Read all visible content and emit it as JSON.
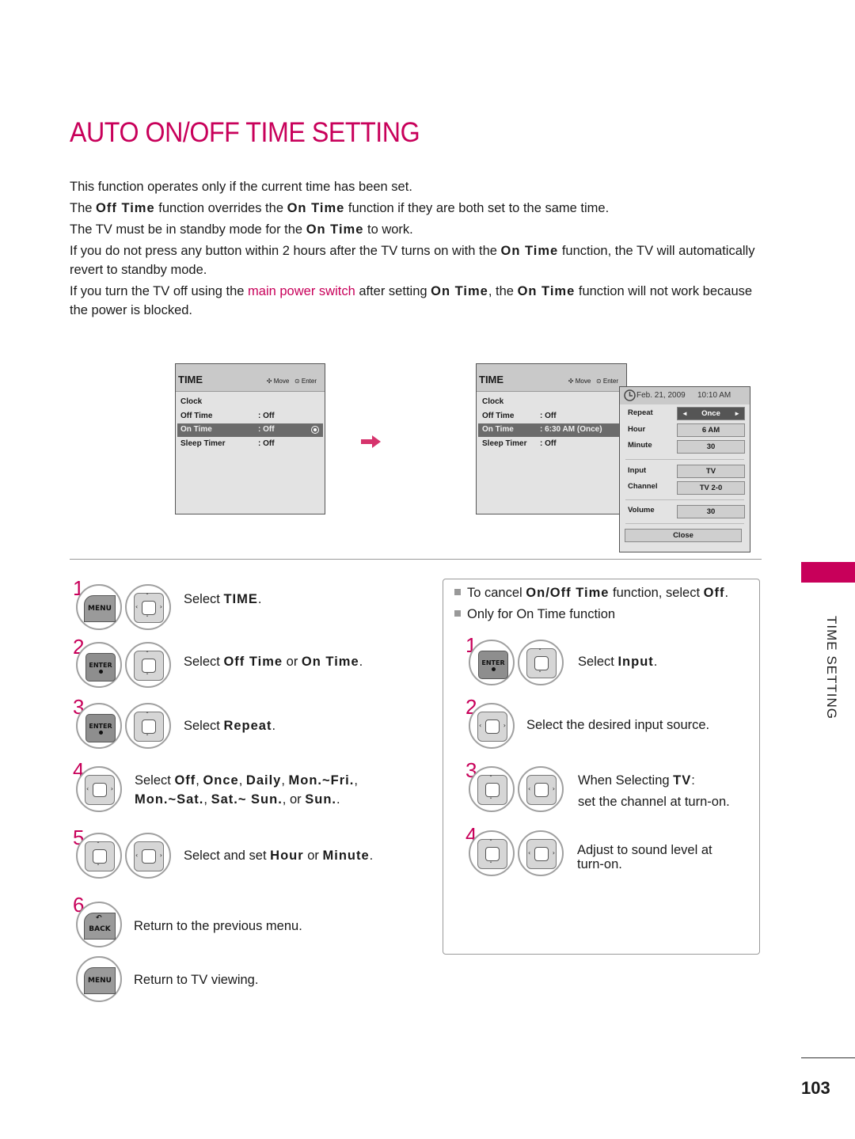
{
  "title": "AUTO ON/OFF TIME SETTING",
  "intro": {
    "p1": "This function operates only if the current time has been set.",
    "p2": {
      "a": "The ",
      "b1": "Off Time",
      "c": " function overrides the ",
      "b2": "On Time",
      "d": " function if they are both set to the same time."
    },
    "p3": {
      "a": "The TV must be in standby mode for the ",
      "b1": "On Time",
      "c": " to work."
    },
    "p4": {
      "a": "If you do not press any button within 2 hours after the TV turns on with the ",
      "b1": "On Time",
      "c": " function, the TV will automatically revert to standby mode."
    },
    "p5": {
      "a": "If you turn the TV off using the ",
      "link": "main power switch",
      "c": " after setting ",
      "b1": "On Time",
      "d": ", the ",
      "b2": "On Time",
      "e": " function will not work because the power is blocked."
    }
  },
  "osd_left": {
    "title": "TIME",
    "hint_move": "Move",
    "hint_enter": "Enter",
    "rows": [
      {
        "label": "Clock",
        "value": ""
      },
      {
        "label": "Off Time",
        "value": ": Off"
      },
      {
        "label": "On Time",
        "value": ": Off",
        "selected": true
      },
      {
        "label": "Sleep Timer",
        "value": ": Off"
      }
    ]
  },
  "osd_right": {
    "title": "TIME",
    "hint_move": "Move",
    "hint_enter": "Enter",
    "rows": [
      {
        "label": "Clock",
        "value": ""
      },
      {
        "label": "Off Time",
        "value": ": Off"
      },
      {
        "label": "On Time",
        "value": ": 6:30 AM (Once)",
        "selected": true
      },
      {
        "label": "Sleep Timer",
        "value": ": Off"
      }
    ]
  },
  "popup": {
    "datetime": "Feb. 21, 2009",
    "clock": "10:10 AM",
    "repeat_label": "Repeat",
    "repeat_value": "Once",
    "hour_label": "Hour",
    "hour_value": "6 AM",
    "minute_label": "Minute",
    "minute_value": "30",
    "input_label": "Input",
    "input_value": "TV",
    "channel_label": "Channel",
    "channel_value": "TV 2-0",
    "volume_label": "Volume",
    "volume_value": "30",
    "close_label": "Close"
  },
  "steps": [
    {
      "num": "1",
      "buttons": [
        "MENU",
        "dpad"
      ],
      "text": {
        "a": "Select ",
        "b": "TIME",
        "c": "."
      }
    },
    {
      "num": "2",
      "buttons": [
        "ENTER",
        "dpad-ud"
      ],
      "text": {
        "a": "Select ",
        "b": "Off Time",
        "c": " or ",
        "d": "On Time",
        "e": "."
      }
    },
    {
      "num": "3",
      "buttons": [
        "ENTER",
        "dpad-ud"
      ],
      "text": {
        "a": "Select ",
        "b": "Repeat",
        "c": "."
      }
    },
    {
      "num": "4",
      "buttons": [
        "dpad-lr"
      ],
      "text": {
        "a": "Select ",
        "b": "Off",
        "c": ", ",
        "d": "Once",
        "e": ", ",
        "f": "Daily",
        "g": ", ",
        "h": "Mon.~Fri.",
        "i": ",",
        "j": "Mon.~Sat.",
        "k": ", ",
        "l": "Sat.~ Sun.",
        "m": ", or ",
        "n": "Sun.",
        "o": "."
      }
    },
    {
      "num": "5",
      "buttons": [
        "dpad-ud",
        "dpad-lr"
      ],
      "text": {
        "a": "Select and set ",
        "b": "Hour",
        "c": " or ",
        "d": "Minute",
        "e": "."
      }
    },
    {
      "num": "6",
      "buttons": [
        "BACK"
      ],
      "text": "Return to the previous menu."
    },
    {
      "num": "",
      "buttons": [
        "MENU"
      ],
      "text": "Return to TV viewing."
    }
  ],
  "notes": {
    "n1": {
      "a": "To cancel ",
      "b": "On/Off Time",
      "c": " function, select ",
      "d": "Off",
      "e": "."
    },
    "n2": "Only for On Time function",
    "substeps": [
      {
        "num": "1",
        "text": {
          "a": "Select ",
          "b": "Input",
          "c": "."
        }
      },
      {
        "num": "2",
        "text": "Select the desired input source."
      },
      {
        "num": "3",
        "text": {
          "a": "When Selecting ",
          "b": "TV",
          "c": ":",
          "line2": "set the channel at turn-on."
        }
      },
      {
        "num": "4",
        "text": {
          "line1": "Adjust to sound level at",
          "line2": "turn-on."
        }
      }
    ]
  },
  "side_label": "TIME SETTING",
  "page_number": "103",
  "buttons": {
    "menu": "MENU",
    "enter": "ENTER",
    "back": "BACK"
  },
  "colors": {
    "accent": "#c8005a"
  }
}
